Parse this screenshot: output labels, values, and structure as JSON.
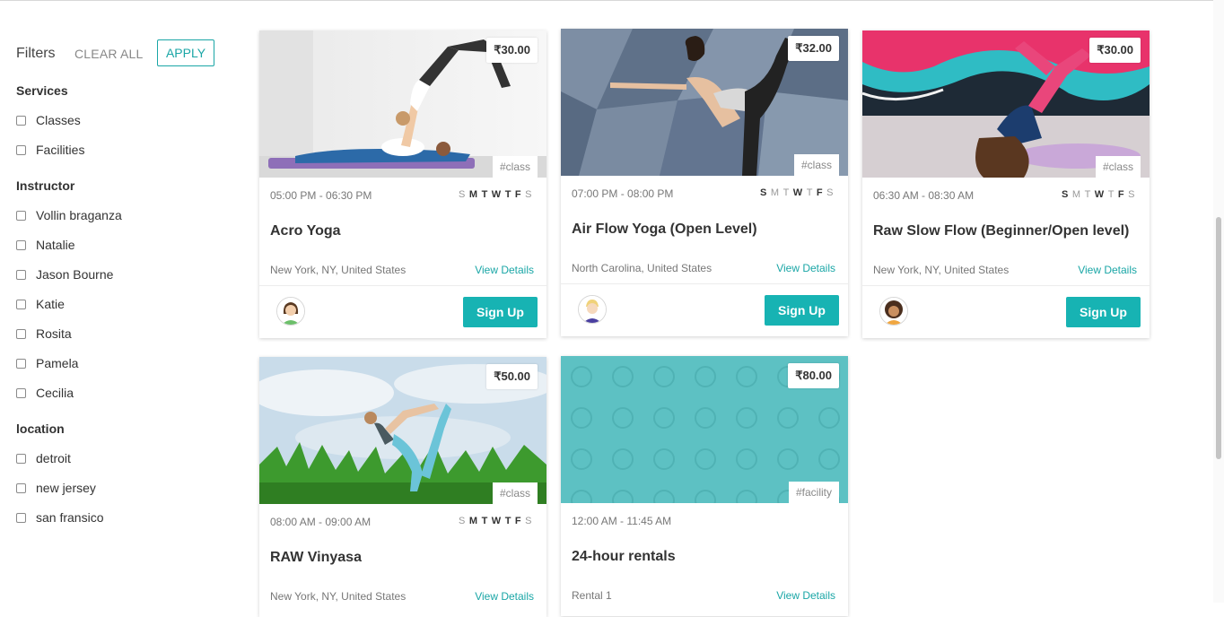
{
  "filters": {
    "title": "Filters",
    "clear_all": "CLEAR ALL",
    "apply": "APPLY",
    "groups": [
      {
        "title": "Services",
        "options": [
          "Classes",
          "Facilities"
        ]
      },
      {
        "title": "Instructor",
        "options": [
          "Vollin braganza",
          "Natalie",
          "Jason Bourne",
          "Katie",
          "Rosita",
          "Pamela",
          "Cecilia"
        ]
      },
      {
        "title": "location",
        "options": [
          "detroit",
          "new jersey",
          "san fransico"
        ]
      }
    ]
  },
  "cards": [
    {
      "title": "Acro Yoga",
      "price": "₹30.00",
      "tag": "#class",
      "time": "05:00 PM - 06:30 PM",
      "days": [
        "S",
        "M",
        "T",
        "W",
        "T",
        "F",
        "S"
      ],
      "days_active": [
        false,
        true,
        true,
        true,
        true,
        true,
        false
      ],
      "location": "New York, NY, United States",
      "details": "View Details",
      "cta": "Sign Up",
      "image": "acro-yoga-photo",
      "avatar": "female-instructor-avatar"
    },
    {
      "title": "Air Flow Yoga (Open Level)",
      "price": "₹32.00",
      "tag": "#class",
      "time": "07:00 PM - 08:00 PM",
      "days": [
        "S",
        "M",
        "T",
        "W",
        "T",
        "F",
        "S"
      ],
      "days_active": [
        true,
        false,
        false,
        true,
        false,
        true,
        false
      ],
      "location": "North Carolina, United States",
      "details": "View Details",
      "cta": "Sign Up",
      "image": "dancer-pose-photo",
      "avatar": "male-instructor-avatar"
    },
    {
      "title": "Raw Slow Flow (Beginner/Open level)",
      "price": "₹30.00",
      "tag": "#class",
      "time": "06:30 AM - 08:30 AM",
      "days": [
        "S",
        "M",
        "T",
        "W",
        "T",
        "F",
        "S"
      ],
      "days_active": [
        true,
        false,
        false,
        true,
        false,
        true,
        false
      ],
      "location": "New York, NY, United States",
      "details": "View Details",
      "cta": "Sign Up",
      "image": "handstand-photo",
      "avatar": "female-instructor-avatar-2"
    },
    {
      "title": "RAW Vinyasa",
      "price": "₹50.00",
      "tag": "#class",
      "time": "08:00 AM - 09:00 AM",
      "days": [
        "S",
        "M",
        "T",
        "W",
        "T",
        "F",
        "S"
      ],
      "days_active": [
        false,
        true,
        true,
        true,
        true,
        true,
        false
      ],
      "location": "New York, NY, United States",
      "details": "View Details",
      "image": "grass-yoga-photo"
    },
    {
      "title": "24-hour rentals",
      "price": "₹80.00",
      "tag": "#facility",
      "time": "12:00 AM - 11:45 AM",
      "location": "Rental 1",
      "details": "View Details",
      "image": "teal-circle-pattern"
    }
  ],
  "colors": {
    "accent": "#17b3b3",
    "pattern_bg": "#5dc1c3"
  }
}
